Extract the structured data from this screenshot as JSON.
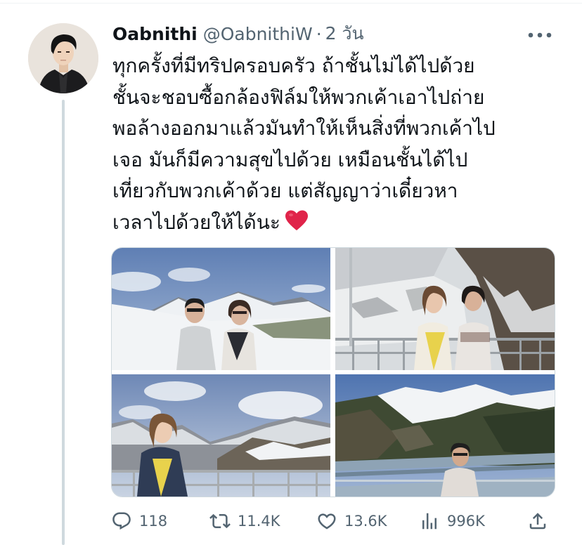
{
  "tweet": {
    "display_name": "Oabnithi",
    "handle": "@OabnithiW",
    "separator": "·",
    "time": "2 วัน",
    "text_lines": [
      "ทุกครั้งที่มีทริปครอบครัว ถ้าชั้นไม่ได้ไปด้วย",
      "ชั้นจะชอบซื้อกล้องฟิล์มให้พวกเค้าเอาไปถ่าย",
      "พอล้างออกมาแล้วมันทำให้เห็นสิ่งที่พวกเค้าไป",
      "เจอ มันก็มีความสุขไปด้วย เหมือนชั้นได้ไป",
      "เที่ยวกับพวกเค้าด้วย แต่สัญญาว่าเดี๋ยวหา",
      "เวลาไปด้วยให้ได้นะ"
    ],
    "emoji": "red-heart",
    "media": [
      {
        "icon": "photo-couple-snow-mountains"
      },
      {
        "icon": "photo-two-women-snowy-slope"
      },
      {
        "icon": "photo-woman-mountain-view"
      },
      {
        "icon": "photo-man-dam-mountains"
      }
    ]
  },
  "actions": {
    "replies": "118",
    "retweets": "11.4K",
    "likes": "13.6K",
    "views": "996K"
  },
  "colors": {
    "text_primary": "#0f1419",
    "text_secondary": "#536471",
    "thread_line": "#cfd9de",
    "heart": "#e0244a"
  }
}
